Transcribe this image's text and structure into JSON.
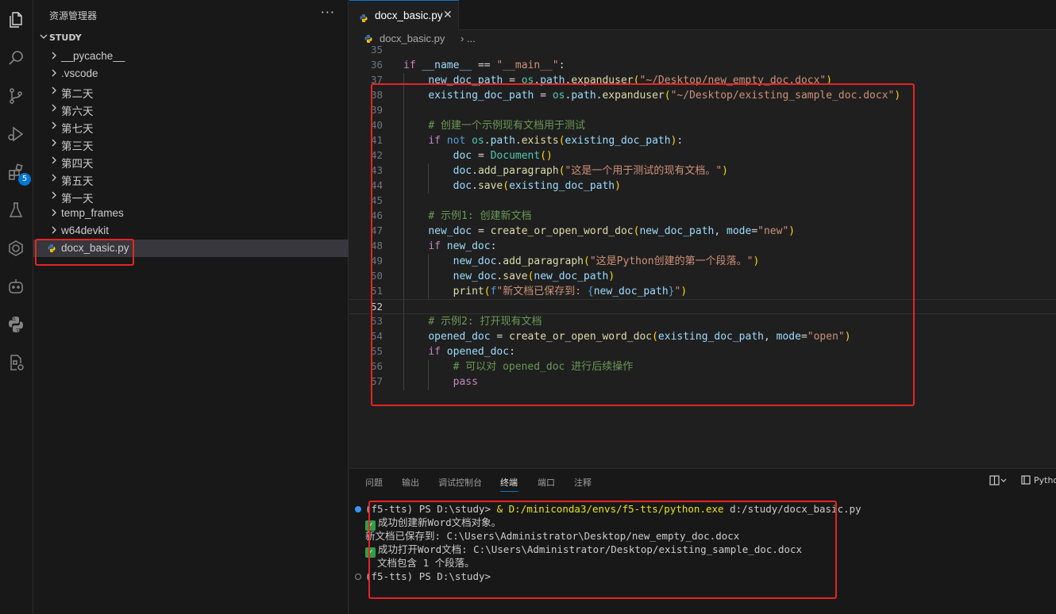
{
  "sidebar": {
    "title": "资源管理器",
    "more": "···",
    "root": "STUDY",
    "items": [
      {
        "label": "__pycache__",
        "type": "folder"
      },
      {
        "label": ".vscode",
        "type": "folder"
      },
      {
        "label": "第二天",
        "type": "folder"
      },
      {
        "label": "第六天",
        "type": "folder"
      },
      {
        "label": "第七天",
        "type": "folder"
      },
      {
        "label": "第三天",
        "type": "folder"
      },
      {
        "label": "第四天",
        "type": "folder"
      },
      {
        "label": "第五天",
        "type": "folder"
      },
      {
        "label": "第一天",
        "type": "folder"
      },
      {
        "label": "temp_frames",
        "type": "folder"
      },
      {
        "label": "w64devkit",
        "type": "folder"
      },
      {
        "label": "docx_basic.py",
        "type": "file",
        "selected": true
      }
    ]
  },
  "activity_bar": {
    "icons": [
      "explorer-icon",
      "search-icon",
      "source-control-icon",
      "run-debug-icon",
      "extensions-icon",
      "testing-icon",
      "remote-icon",
      "copilot-icon",
      "python-icon",
      "settings-sync-icon"
    ],
    "extensions_badge": "5"
  },
  "editor": {
    "tab": {
      "label": "docx_basic.py",
      "close": "✕"
    },
    "breadcrumb": {
      "file": "docx_basic.py",
      "rest": "› ..."
    },
    "line_numbers": [
      "35",
      "36",
      "37",
      "38",
      "39",
      "40",
      "41",
      "42",
      "43",
      "44",
      "45",
      "46",
      "47",
      "48",
      "49",
      "50",
      "51",
      "52",
      "53",
      "54",
      "55",
      "56",
      "57"
    ],
    "current_line": "52"
  },
  "panel": {
    "tabs": [
      "问题",
      "输出",
      "调试控制台",
      "终端",
      "端口",
      "注释"
    ],
    "active_tab": "终端",
    "right_label": "Pytho",
    "terminal": {
      "line1_prompt": "(f5-tts) PS D:\\study> ",
      "line1_amp": "& ",
      "line1_exe": "D:/miniconda3/envs/f5-tts/python.exe",
      "line1_arg": " d:/study/docx_basic.py",
      "line2": "成功创建新Word文档对象。",
      "line3": "新文档已保存到: C:\\Users\\Administrator\\Desktop/new_empty_doc.docx",
      "line4": "成功打开Word文档: C:\\Users\\Administrator/Desktop/existing_sample_doc.docx",
      "line5": "  文档包含 1 个段落。",
      "line6": "(f5-tts) PS D:\\study>"
    }
  },
  "colors": {
    "accent": "#0078d4",
    "highlight_box": "#e62424",
    "success": "#2ea043"
  }
}
